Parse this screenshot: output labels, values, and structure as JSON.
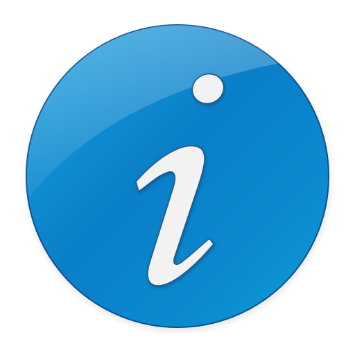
{
  "icon": {
    "name": "info-icon",
    "glyph": "i",
    "colors": {
      "circle_light": "#1fa3df",
      "circle_mid": "#0a86cd",
      "circle_dark": "#0669b6",
      "rim": "#0b4f8f",
      "glyph_fill": "#f1f2f1",
      "glyph_outline": "#1a5a86",
      "background": "#ffffff"
    }
  }
}
